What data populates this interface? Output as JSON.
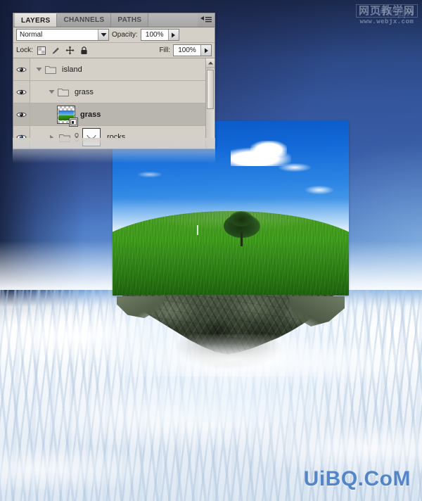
{
  "panel": {
    "tabs": [
      {
        "label": "LAYERS",
        "active": true
      },
      {
        "label": "CHANNELS",
        "active": false
      },
      {
        "label": "PATHS",
        "active": false
      }
    ],
    "menu_icon": "panel-menu-icon",
    "blend_mode": {
      "value": "Normal",
      "dropdown_icon": "chevron-down-icon"
    },
    "opacity": {
      "label": "Opacity:",
      "value": "100%",
      "spinner_icon": "triangle-right-icon"
    },
    "fill": {
      "label": "Fill:",
      "value": "100%",
      "spinner_icon": "triangle-right-icon"
    },
    "lock": {
      "label": "Lock:",
      "icons": [
        "lock-transparency-icon",
        "lock-image-brush-icon",
        "lock-position-move-icon",
        "lock-all-padlock-icon"
      ]
    },
    "layers": [
      {
        "name": "island",
        "type": "group",
        "visible": true,
        "expanded": true,
        "selected": false,
        "indent": 1,
        "twisty_icon": "triangle-down-icon",
        "icon": "folder-icon",
        "eye_icon": "eye-visible-icon"
      },
      {
        "name": "grass",
        "type": "group",
        "visible": true,
        "expanded": true,
        "selected": false,
        "indent": 2,
        "twisty_icon": "triangle-down-icon",
        "icon": "folder-icon",
        "eye_icon": "eye-visible-icon"
      },
      {
        "name": "grass",
        "type": "layer",
        "visible": true,
        "selected": true,
        "indent": 3,
        "icon": "layer-thumbnail",
        "badge_icon": "layer-mask-badge-icon",
        "eye_icon": "eye-visible-icon"
      },
      {
        "name": "rocks",
        "type": "group",
        "visible": true,
        "expanded": false,
        "selected": false,
        "indent": 2,
        "twisty_icon": "triangle-right-icon",
        "icon": "folder-icon",
        "link_icon": "mask-link-icon",
        "mask_icon": "vector-mask-thumbnail",
        "eye_icon": "eye-visible-icon"
      }
    ],
    "scrollbar": {
      "up_icon": "scroll-up-arrow-icon"
    }
  },
  "canvas": {
    "artwork_name": "floating-island-composite",
    "photo_alt": "grass-hill-with-tree-and-blue-sky",
    "rocks_alt": "rock-underside-of-floating-island",
    "clouds_alt": "sea-of-clouds"
  },
  "watermarks": {
    "top": {
      "text_cn": "网页教学网",
      "url": "www.webjx.com"
    },
    "bottom": {
      "text": "UiBQ.CoM"
    }
  },
  "colors": {
    "sky_top": "#223158",
    "sky_mid": "#4a77c4",
    "cloud": "#ffffff",
    "grass": "#3f9b1c",
    "rock": "#424e3b",
    "panel_bg": "#d4d0c8",
    "watermark_blue": "#4a7ec4"
  }
}
